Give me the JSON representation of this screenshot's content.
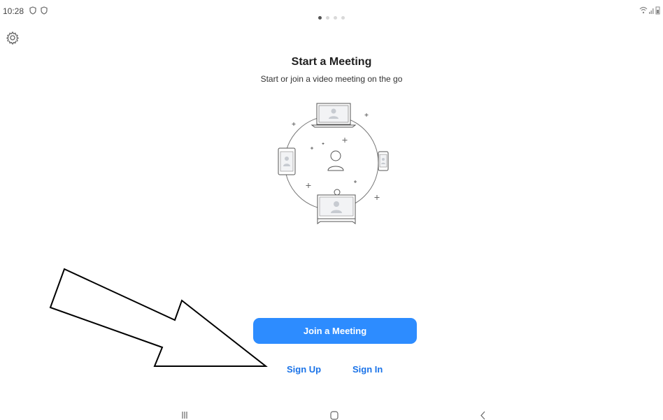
{
  "status_bar": {
    "time": "10:28",
    "notification_icons": [
      "shield-icon",
      "shield-icon"
    ],
    "right_icons": [
      "wifi-icon",
      "signal-icon",
      "battery-icon"
    ]
  },
  "toolbar": {
    "settings_icon": "gear-icon"
  },
  "pager": {
    "count": 4,
    "active_index": 0
  },
  "onboarding": {
    "title": "Start a Meeting",
    "subtitle": "Start or join a video meeting on the go"
  },
  "actions": {
    "join_label": "Join a Meeting",
    "signup_label": "Sign Up",
    "signin_label": "Sign In"
  },
  "colors": {
    "accent": "#2d8cff",
    "link": "#1a73e8"
  },
  "nav_bar": {
    "icons": [
      "recent-apps-icon",
      "home-icon",
      "back-icon"
    ]
  }
}
